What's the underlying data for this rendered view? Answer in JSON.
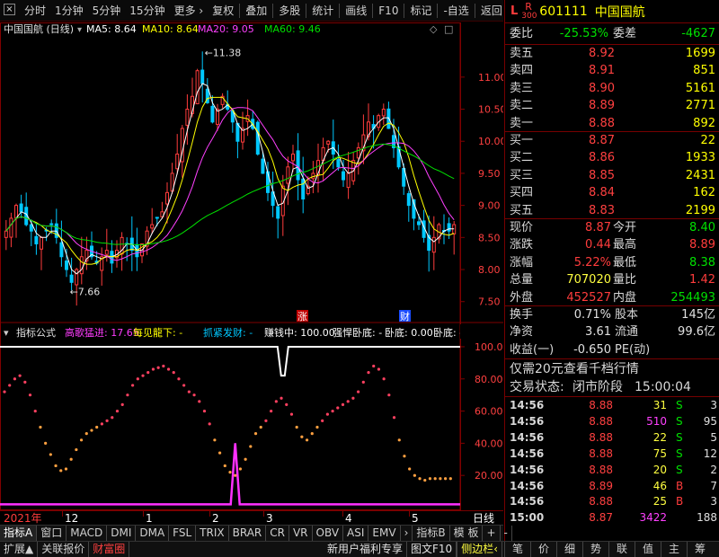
{
  "toolbar": {
    "close": "×",
    "left_items": [
      "分时",
      "1分钟",
      "5分钟",
      "15分钟",
      "更多 ›"
    ],
    "right_items": [
      "复权",
      "叠加",
      "多股",
      "统计",
      "画线",
      "F10",
      "标记",
      "-自选",
      "返回"
    ]
  },
  "chart": {
    "title": "中国国航 (日线)",
    "ma": [
      {
        "label": "MA5: 8.64",
        "color": "#ffffff"
      },
      {
        "label": "MA10: 8.64",
        "color": "#ffff00"
      },
      {
        "label": "MA20: 9.05",
        "color": "#ff40ff"
      },
      {
        "label": "MA60: 9.46",
        "color": "#00e000"
      }
    ],
    "high_label": "11.38",
    "low_label": "7.66",
    "events": [
      "涨",
      "财"
    ],
    "yticks": [
      "11.00",
      "10.50",
      "10.00",
      "9.50",
      "9.00",
      "8.50",
      "8.00",
      "7.50"
    ],
    "ind_title": "指标公式",
    "ind_items": [
      {
        "label": "高歌猛进: 17.65",
        "color": "#ff3cff"
      },
      {
        "label": "每见龍下: -",
        "color": "#ffff00"
      },
      {
        "label": "抓紧发财: -",
        "color": "#00c8ff"
      },
      {
        "label": "赚钱中: 100.00",
        "color": "#ffffff"
      },
      {
        "label": "强悍卧底: -",
        "color": "#ffffff"
      },
      {
        "label": "卧底: 0.00",
        "color": "#ffffff"
      },
      {
        "label": "卧底: -",
        "color": "#ffffff"
      },
      {
        "label": "开始",
        "color": "#ff40ff"
      }
    ],
    "ind_yticks": [
      "100.00",
      "80.00",
      "60.00",
      "40.00",
      "20.00"
    ],
    "xaxis": [
      {
        "label": "2021年",
        "color": "#ff3c3c"
      },
      {
        "label": "12",
        "color": "#ffffff"
      },
      {
        "label": "1",
        "color": "#ffffff"
      },
      {
        "label": "2",
        "color": "#ffffff"
      },
      {
        "label": "3",
        "color": "#ffffff"
      },
      {
        "label": "4",
        "color": "#ffffff"
      },
      {
        "label": "5",
        "color": "#ffffff"
      }
    ],
    "period_label": "日线"
  },
  "chart_data": {
    "type": "line",
    "price_range": [
      7.3,
      11.6
    ],
    "close": [
      8.6,
      8.8,
      9.0,
      8.9,
      8.7,
      8.6,
      8.4,
      8.5,
      8.6,
      8.7,
      8.5,
      8.2,
      8.0,
      7.8,
      8.0,
      8.2,
      8.3,
      8.2,
      8.1,
      8.2,
      8.3,
      8.1,
      8.3,
      8.5,
      8.4,
      8.3,
      8.2,
      8.4,
      8.6,
      8.7,
      8.8,
      8.9,
      9.2,
      9.5,
      9.8,
      10.2,
      10.5,
      10.7,
      11.1,
      10.9,
      10.6,
      10.3,
      10.5,
      10.7,
      10.5,
      10.3,
      10.0,
      10.2,
      10.4,
      10.2,
      9.8,
      9.5,
      9.2,
      9.0,
      8.8,
      9.3,
      9.6,
      9.8,
      9.4,
      9.1,
      9.3,
      9.5,
      9.7,
      9.9,
      10.0,
      9.8,
      9.6,
      9.4,
      9.5,
      9.7,
      9.9,
      10.1,
      10.3,
      10.2,
      10.4,
      10.5,
      10.2,
      9.9,
      9.6,
      9.3,
      9.0,
      8.8,
      8.7,
      8.5,
      8.3,
      8.5,
      8.7,
      8.6,
      8.6,
      8.7
    ],
    "indicator_range": [
      0,
      105
    ],
    "indicator": [
      72,
      76,
      80,
      82,
      78,
      70,
      60,
      50,
      40,
      33,
      26,
      23,
      24,
      30,
      36,
      42,
      46,
      48,
      50,
      52,
      54,
      56,
      60,
      64,
      70,
      76,
      80,
      82,
      84,
      86,
      87,
      88,
      86,
      84,
      80,
      76,
      72,
      70,
      66,
      60,
      52,
      42,
      34,
      26,
      22,
      20,
      24,
      30,
      38,
      46,
      50,
      54,
      60,
      66,
      68,
      64,
      58,
      50,
      44,
      42,
      46,
      50,
      54,
      58,
      60,
      62,
      64,
      66,
      68,
      72,
      78,
      84,
      88,
      86,
      80,
      70,
      56,
      42,
      32,
      24,
      20,
      18,
      17,
      18,
      18,
      18,
      18,
      18
    ],
    "indicator_spike_index": 45,
    "white_dip_index": 55
  },
  "quote": {
    "code": "601111",
    "name": "中国国航",
    "flag_l": "L",
    "flag_r": "R",
    "flag_n": "300",
    "webi_label": "委比",
    "webi_value": "-25.53%",
    "weicha_label": "委差",
    "weicha_value": "-4627",
    "sell": [
      {
        "label": "卖五",
        "price": "8.92",
        "vol": "1699"
      },
      {
        "label": "卖四",
        "price": "8.91",
        "vol": "851"
      },
      {
        "label": "卖三",
        "price": "8.90",
        "vol": "5161"
      },
      {
        "label": "卖二",
        "price": "8.89",
        "vol": "2771"
      },
      {
        "label": "卖一",
        "price": "8.88",
        "vol": "892"
      }
    ],
    "buy": [
      {
        "label": "买一",
        "price": "8.87",
        "vol": "22"
      },
      {
        "label": "买二",
        "price": "8.86",
        "vol": "1933"
      },
      {
        "label": "买三",
        "price": "8.85",
        "vol": "2431"
      },
      {
        "label": "买四",
        "price": "8.84",
        "vol": "162"
      },
      {
        "label": "买五",
        "price": "8.83",
        "vol": "2199"
      }
    ],
    "stats": [
      {
        "l1": "现价",
        "v1": "8.87",
        "c1": "red",
        "l2": "今开",
        "v2": "8.40",
        "c2": "green"
      },
      {
        "l1": "涨跌",
        "v1": "0.44",
        "c1": "red",
        "l2": "最高",
        "v2": "8.89",
        "c2": "red"
      },
      {
        "l1": "涨幅",
        "v1": "5.22%",
        "c1": "red",
        "l2": "最低",
        "v2": "8.38",
        "c2": "green"
      },
      {
        "l1": "总量",
        "v1": "707020",
        "c1": "yellow",
        "l2": "量比",
        "v2": "1.42",
        "c2": "red"
      },
      {
        "l1": "外盘",
        "v1": "452527",
        "c1": "red",
        "l2": "内盘",
        "v2": "254493",
        "c2": "green"
      }
    ],
    "stats2": [
      {
        "l1": "换手",
        "v1": "0.71%",
        "l2": "股本",
        "v2": "145亿"
      },
      {
        "l1": "净资",
        "v1": "3.61",
        "l2": "流通",
        "v2": "99.6亿"
      },
      {
        "l1": "收益(一)",
        "v1": "-0.650",
        "l2": "PE(动)",
        "v2": ""
      }
    ],
    "promo": "仅需20元查看千档行情",
    "status_label": "交易状态:",
    "status_value": "闭市阶段",
    "status_time": "15:00:04",
    "ticks": [
      {
        "t": "14:56",
        "p": "8.88",
        "v": "31",
        "vc": "yellow",
        "s": "S",
        "sc": "green",
        "n": "3"
      },
      {
        "t": "14:56",
        "p": "8.88",
        "v": "510",
        "vc": "magenta",
        "s": "S",
        "sc": "green",
        "n": "95"
      },
      {
        "t": "14:56",
        "p": "8.88",
        "v": "22",
        "vc": "yellow",
        "s": "S",
        "sc": "green",
        "n": "5"
      },
      {
        "t": "14:56",
        "p": "8.88",
        "v": "75",
        "vc": "yellow",
        "s": "S",
        "sc": "green",
        "n": "12"
      },
      {
        "t": "14:56",
        "p": "8.88",
        "v": "20",
        "vc": "yellow",
        "s": "S",
        "sc": "green",
        "n": "2"
      },
      {
        "t": "14:56",
        "p": "8.89",
        "v": "46",
        "vc": "yellow",
        "s": "B",
        "sc": "red",
        "n": "7"
      },
      {
        "t": "14:56",
        "p": "8.88",
        "v": "25",
        "vc": "yellow",
        "s": "B",
        "sc": "red",
        "n": "3"
      },
      {
        "t": "15:00",
        "p": "8.87",
        "v": "3422",
        "vc": "magenta",
        "s": "",
        "sc": "white",
        "n": "188"
      }
    ]
  },
  "bottom": {
    "tabs1": [
      "指标A",
      "窗口",
      "MACD",
      "DMI",
      "DMA",
      "FSL",
      "TRIX",
      "BRAR",
      "CR",
      "VR",
      "OBV",
      "ASI",
      "EMV",
      "›",
      "指标B",
      "模 板",
      "+",
      "-"
    ],
    "tabs2": [
      "扩展▲",
      "关联报价",
      "财富圈"
    ],
    "promo2": "新用户福利专享",
    "mid": [
      "图文F10",
      "侧边栏‹"
    ],
    "right": [
      "笔",
      "价",
      "细",
      "势",
      "联",
      "值",
      "主",
      "筹"
    ]
  }
}
